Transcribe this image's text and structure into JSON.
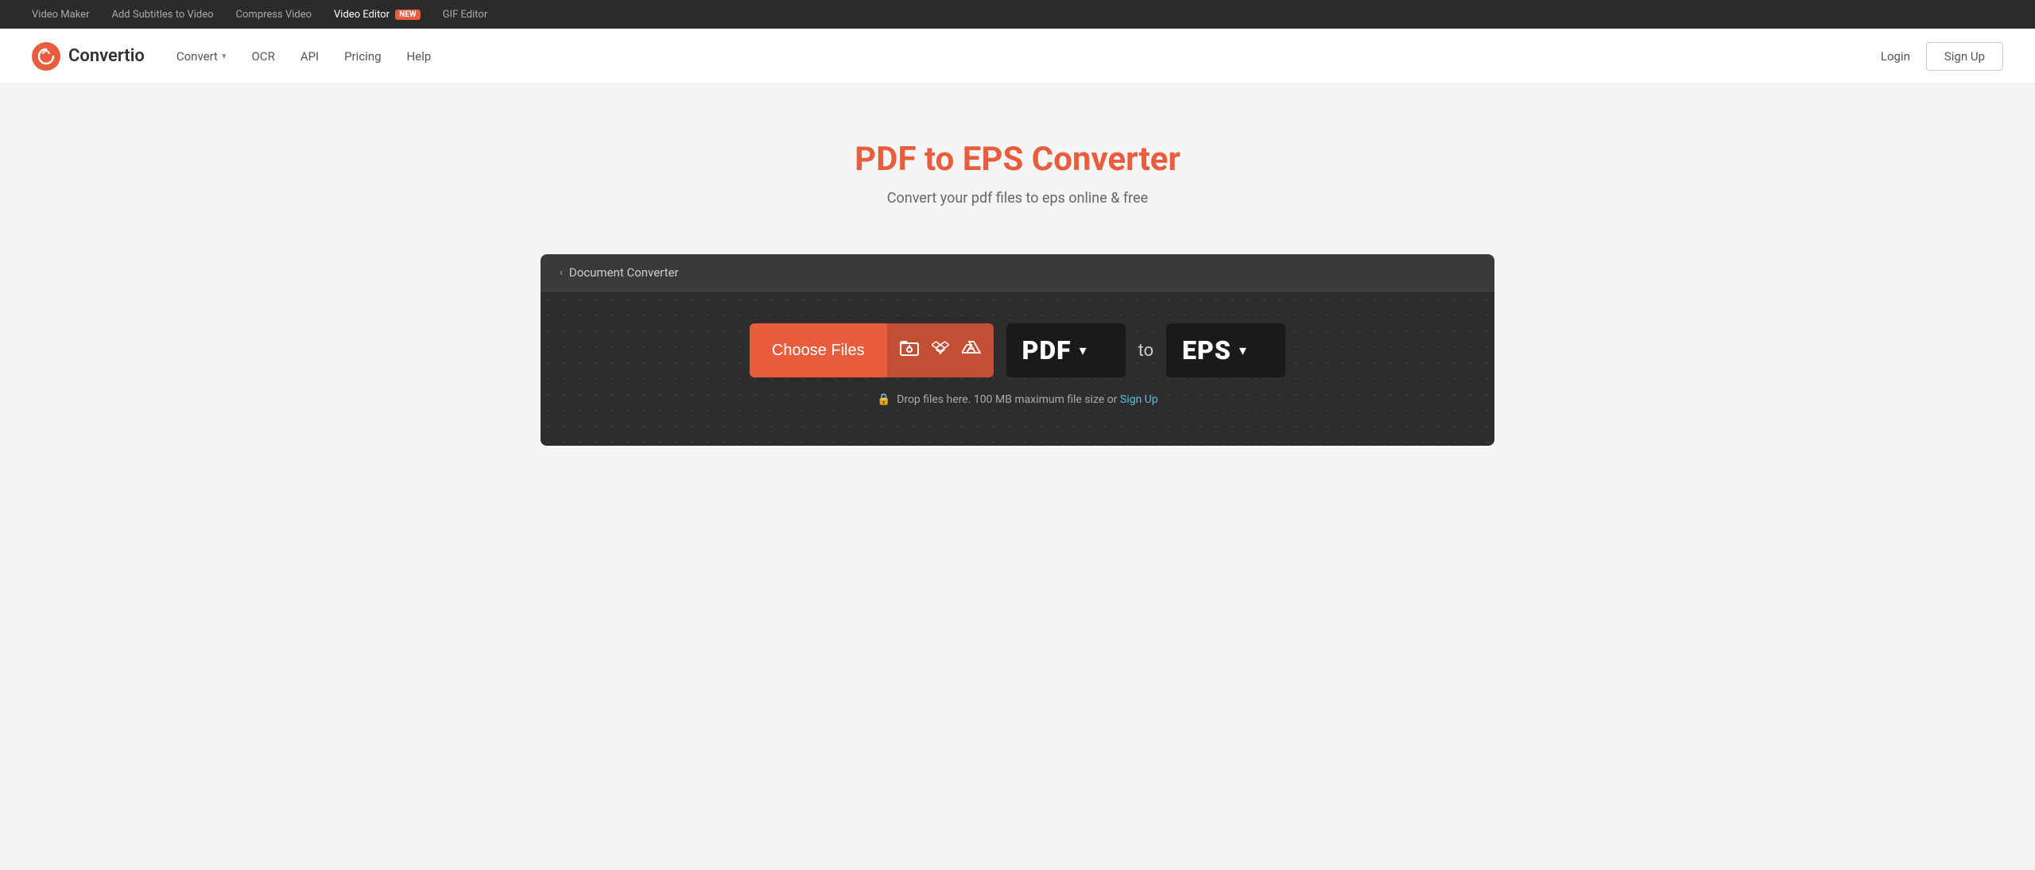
{
  "topbar": {
    "links": [
      {
        "label": "Video Maker",
        "active": false
      },
      {
        "label": "Add Subtitles to Video",
        "active": false
      },
      {
        "label": "Compress Video",
        "active": false
      },
      {
        "label": "Video Editor",
        "active": true,
        "badge": "NEW"
      },
      {
        "label": "GIF Editor",
        "active": false
      }
    ]
  },
  "nav": {
    "logo_text": "Convertio",
    "links": [
      {
        "label": "Convert",
        "has_dropdown": true
      },
      {
        "label": "OCR"
      },
      {
        "label": "API"
      },
      {
        "label": "Pricing"
      },
      {
        "label": "Help"
      }
    ],
    "login_label": "Login",
    "signup_label": "Sign Up"
  },
  "hero": {
    "title": "PDF to EPS Converter",
    "subtitle": "Convert your pdf files to eps online & free"
  },
  "converter": {
    "breadcrumb": "Document Converter",
    "choose_files_label": "Choose Files",
    "from_format": "PDF",
    "to_word": "to",
    "to_format": "EPS",
    "drop_note": "Drop files here. 100 MB maximum file size or",
    "signup_link_label": "Sign Up"
  }
}
